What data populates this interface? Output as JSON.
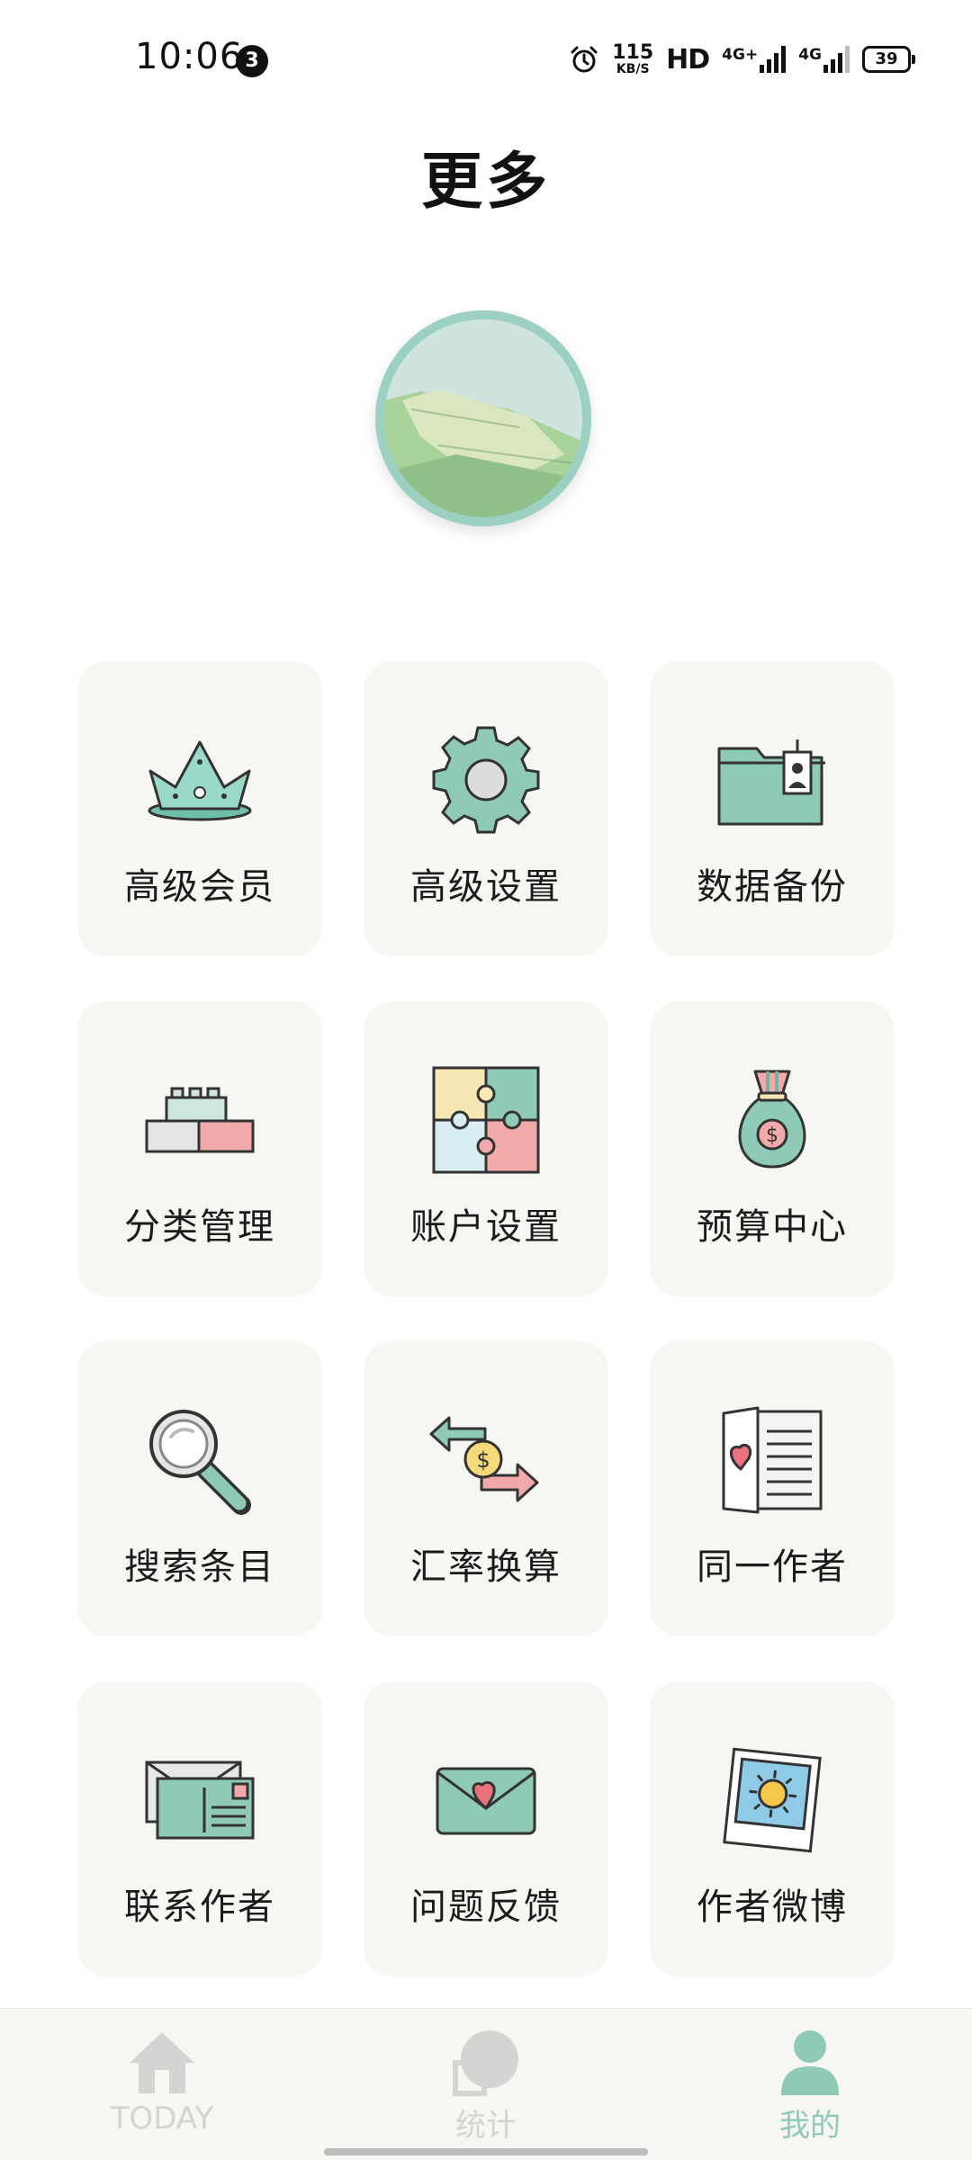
{
  "status_bar": {
    "time": "10:06",
    "notification_count": "3",
    "speed_value": "115",
    "speed_unit": "KB/S",
    "hd_label": "HD",
    "network_1": "4G+",
    "network_2": "4G",
    "battery": "39"
  },
  "header": {
    "title": "更多"
  },
  "grid": {
    "items": [
      {
        "label": "高级会员",
        "icon": "crown-icon"
      },
      {
        "label": "高级设置",
        "icon": "gear-icon"
      },
      {
        "label": "数据备份",
        "icon": "folder-icon"
      },
      {
        "label": "分类管理",
        "icon": "blocks-icon"
      },
      {
        "label": "账户设置",
        "icon": "puzzle-icon"
      },
      {
        "label": "预算中心",
        "icon": "money-bag-icon"
      },
      {
        "label": "搜索条目",
        "icon": "magnifier-icon"
      },
      {
        "label": "汇率换算",
        "icon": "exchange-icon"
      },
      {
        "label": "同一作者",
        "icon": "book-icon"
      },
      {
        "label": "联系作者",
        "icon": "postcard-icon"
      },
      {
        "label": "问题反馈",
        "icon": "heart-envelope-icon"
      },
      {
        "label": "作者微博",
        "icon": "sun-photo-icon"
      }
    ]
  },
  "bottom_nav": {
    "items": [
      {
        "label": "TODAY",
        "icon": "home-icon",
        "active": false
      },
      {
        "label": "统计",
        "icon": "chart-icon",
        "active": false
      },
      {
        "label": "我的",
        "icon": "user-icon",
        "active": true
      }
    ]
  },
  "colors": {
    "mint": "#9ad0c0",
    "pink": "#f2a9a9",
    "tile_bg": "#f6f6f3",
    "nav_inactive": "#d4d4d2"
  }
}
